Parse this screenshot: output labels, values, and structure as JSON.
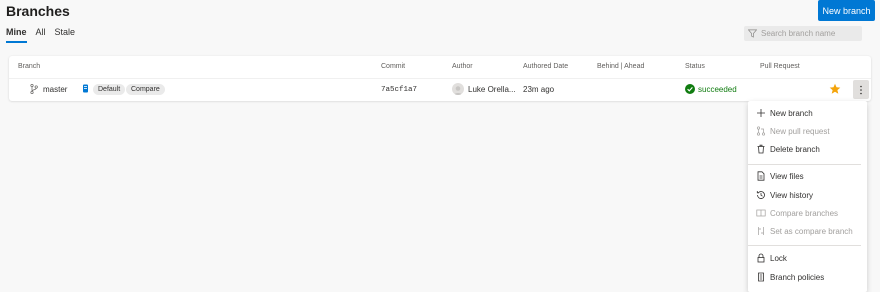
{
  "header": {
    "title": "Branches",
    "new_branch_label": "New branch"
  },
  "tabs": [
    {
      "label": "Mine",
      "active": true
    },
    {
      "label": "All",
      "active": false
    },
    {
      "label": "Stale",
      "active": false
    }
  ],
  "search": {
    "placeholder": "Search branch name"
  },
  "table": {
    "columns": {
      "branch": "Branch",
      "commit": "Commit",
      "author": "Author",
      "authored_date": "Authored Date",
      "behind_ahead": "Behind | Ahead",
      "status": "Status",
      "pull_request": "Pull Request"
    },
    "rows": [
      {
        "branch": "master",
        "default_badge": "Default",
        "compare_badge": "Compare",
        "commit": "7a5cf1a7",
        "author": "Luke Orella...",
        "authored_date": "23m ago",
        "status": "succeeded"
      }
    ]
  },
  "menu": {
    "items": [
      {
        "label": "New branch",
        "icon": "plus-icon",
        "disabled": false
      },
      {
        "label": "New pull request",
        "icon": "pull-request-icon",
        "disabled": true
      },
      {
        "label": "Delete branch",
        "icon": "trash-icon",
        "disabled": false
      },
      {
        "label": "View files",
        "icon": "file-icon",
        "disabled": false
      },
      {
        "label": "View history",
        "icon": "history-icon",
        "disabled": false
      },
      {
        "label": "Compare branches",
        "icon": "compare-icon",
        "disabled": true
      },
      {
        "label": "Set as compare branch",
        "icon": "set-compare-icon",
        "disabled": true
      },
      {
        "label": "Lock",
        "icon": "lock-icon",
        "disabled": false
      },
      {
        "label": "Branch policies",
        "icon": "policy-icon",
        "disabled": false
      }
    ]
  },
  "colors": {
    "accent": "#0078d4",
    "success": "#107c10",
    "star": "#f4a40b",
    "disabled_text": "#a19f9d"
  }
}
